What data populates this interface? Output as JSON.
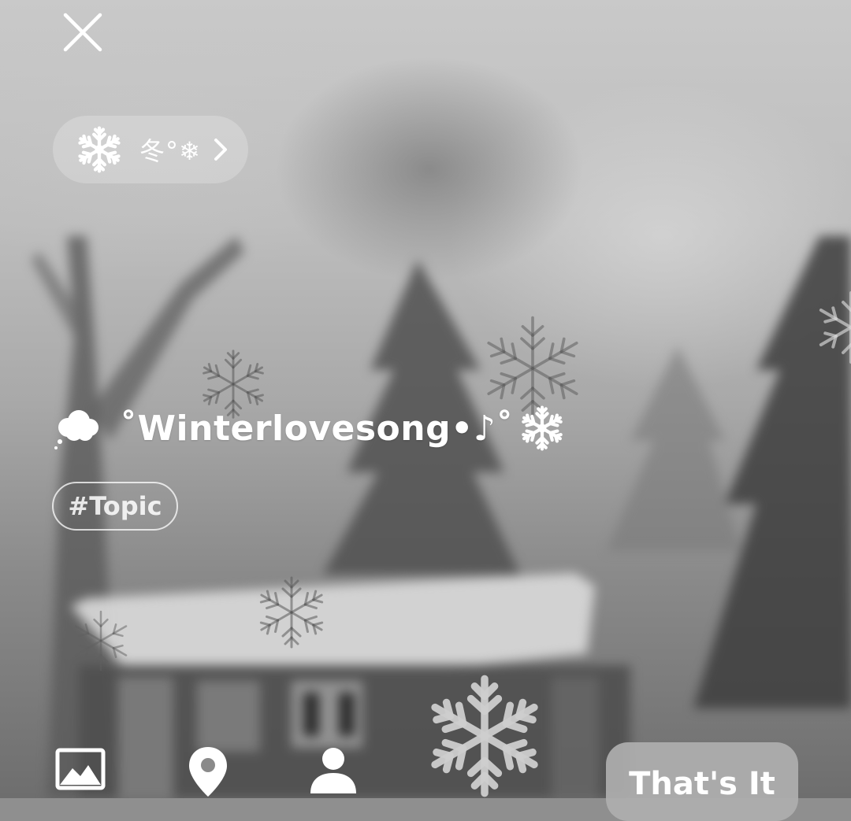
{
  "header": {
    "close_icon": "close-icon"
  },
  "music_chip": {
    "icon": "snowflake-icon",
    "label": "冬°❄",
    "chevron": "chevron-right-icon"
  },
  "post": {
    "leading_icon": "cloud-icon",
    "title": "˚Winterlovesong•♪˚",
    "trailing_icon": "snowflake-icon"
  },
  "topic_tag": {
    "label": "#Topic"
  },
  "toolbar": {
    "image_icon": "image-icon",
    "location_icon": "location-pin-icon",
    "person_icon": "person-icon",
    "done_label": "That's It"
  },
  "colors": {
    "text": "#ffffff",
    "chip_bg": "rgba(255,255,255,0.22)",
    "button_bg": "#afafaf"
  }
}
